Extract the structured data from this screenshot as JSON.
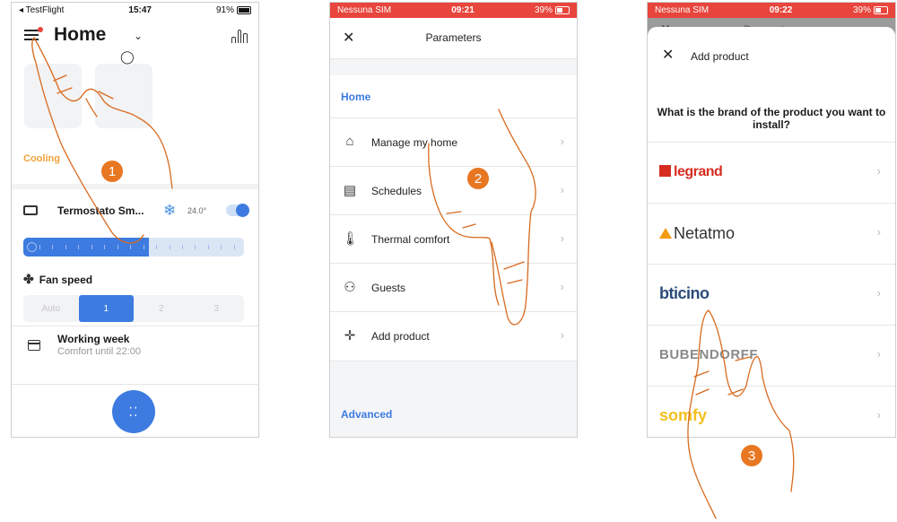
{
  "phone1": {
    "status": {
      "carrier": "◂ TestFlight",
      "time": "15:47",
      "battery": "91%"
    },
    "title": "Home",
    "cooling_label": "Cooling",
    "thermostat": {
      "name": "Termostato Sm...",
      "temp": "24.0°"
    },
    "slider_level": 0.57,
    "fan_speed_title": "Fan speed",
    "fan_options": [
      "Auto",
      "1",
      "2",
      "3"
    ],
    "fan_selected": "1",
    "schedule": {
      "title": "Working week",
      "subtitle": "Comfort until 22:00"
    },
    "step": "1"
  },
  "phone2": {
    "status": {
      "carrier": "Nessuna SIM",
      "time": "09:21",
      "battery": "39%"
    },
    "header_title": "Parameters",
    "section_home": "Home",
    "items": [
      {
        "label": "Manage my home",
        "icon": "house-icon"
      },
      {
        "label": "Schedules",
        "icon": "calendar-icon"
      },
      {
        "label": "Thermal comfort",
        "icon": "thermometer-icon"
      },
      {
        "label": "Guests",
        "icon": "guests-icon"
      },
      {
        "label": "Add product",
        "icon": "plus-icon"
      }
    ],
    "section_advanced": "Advanced",
    "step": "2"
  },
  "phone3": {
    "status": {
      "carrier": "Nessuna SIM",
      "time": "09:22",
      "battery": "39%"
    },
    "dim_title": "Parameters",
    "sheet_title": "Add product",
    "question": "What is the brand of the product you want to install?",
    "brands": [
      "legrand",
      "Netatmo",
      "bticino",
      "BUBENDORFF",
      "somfy"
    ],
    "step": "3"
  },
  "colors": {
    "accent": "#3d7be0",
    "cooling": "#f0a23a",
    "status_red": "#e8453c",
    "step_orange": "#e87722"
  }
}
